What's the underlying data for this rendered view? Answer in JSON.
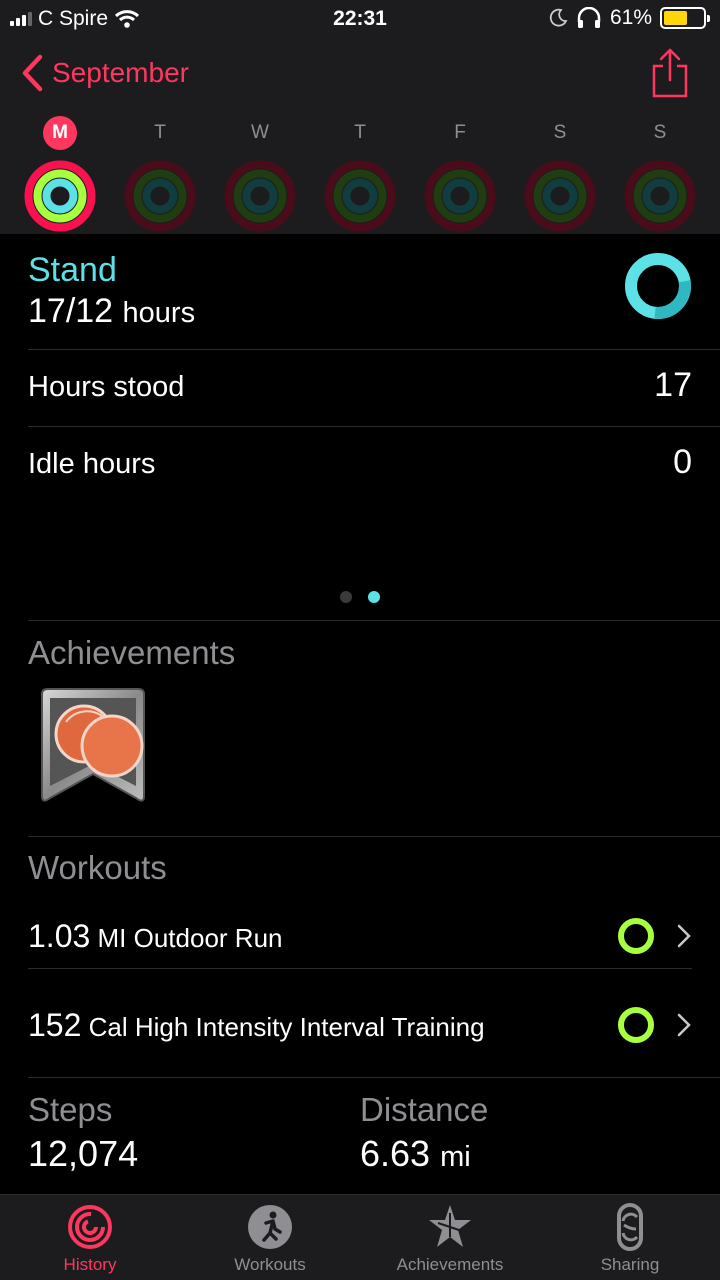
{
  "status": {
    "carrier": "C Spire",
    "time": "22:31",
    "battery": "61%",
    "battery_level": 0.61
  },
  "nav": {
    "back_label": "September"
  },
  "week": [
    {
      "label": "M",
      "current": true
    },
    {
      "label": "T",
      "current": false
    },
    {
      "label": "W",
      "current": false
    },
    {
      "label": "T",
      "current": false
    },
    {
      "label": "F",
      "current": false
    },
    {
      "label": "S",
      "current": false
    },
    {
      "label": "S",
      "current": false
    }
  ],
  "stand": {
    "title": "Stand",
    "value": "17/12",
    "unit": "hours"
  },
  "rows": [
    {
      "label": "Hours stood",
      "value": "17"
    },
    {
      "label": "Idle hours",
      "value": "0"
    }
  ],
  "achievements": {
    "title": "Achievements"
  },
  "workouts": {
    "title": "Workouts",
    "items": [
      {
        "value": "1.03",
        "text": "MI Outdoor Run"
      },
      {
        "value": "152",
        "text": "Cal High Intensity Interval Training"
      }
    ]
  },
  "steps": {
    "label": "Steps",
    "value": "12,074"
  },
  "distance": {
    "label": "Distance",
    "value": "6.63",
    "unit": "mi"
  },
  "tabs": [
    {
      "label": "History",
      "active": true,
      "icon": "history-icon"
    },
    {
      "label": "Workouts",
      "active": false,
      "icon": "workouts-icon"
    },
    {
      "label": "Achievements",
      "active": false,
      "icon": "achievements-icon"
    },
    {
      "label": "Sharing",
      "active": false,
      "icon": "sharing-icon"
    }
  ],
  "colors": {
    "accent": "#ff375f",
    "stand": "#5ce1e6",
    "exercise": "#a6ff3f",
    "move": "#fa114f"
  }
}
